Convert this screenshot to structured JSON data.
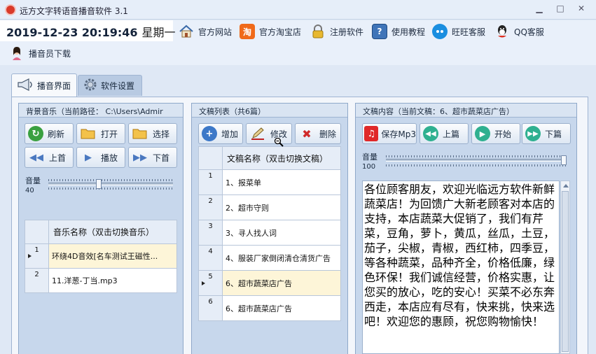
{
  "window": {
    "title": "远方文字转语音播音软件 3.1",
    "minimize_label": "▭",
    "restore_label": "□",
    "close_label": "✕"
  },
  "toolbar": {
    "date": "2019-12-23 20:19:46",
    "weekday": "星期一",
    "items": [
      {
        "label": "官方网站",
        "icon": "home-icon"
      },
      {
        "label": "官方淘宝店",
        "icon": "taobao-icon",
        "glyph": "淘"
      },
      {
        "label": "注册软件",
        "icon": "lock-icon"
      },
      {
        "label": "使用教程",
        "icon": "help-book-icon",
        "glyph": "?"
      },
      {
        "label": "旺旺客服",
        "icon": "wangwang-icon"
      },
      {
        "label": "QQ客服",
        "icon": "qq-icon"
      },
      {
        "label": "播音员下载",
        "icon": "announcer-icon"
      }
    ]
  },
  "tabs": [
    {
      "label": "播音界面",
      "active": true
    },
    {
      "label": "软件设置",
      "active": false
    }
  ],
  "music_panel": {
    "title": "背景音乐（当前路径：  C:\\Users\\Admir",
    "buttons": [
      "刷新",
      "打开",
      "选择",
      "上首",
      "播放",
      "下首"
    ],
    "volume_label": "音量",
    "volume_value": "40",
    "volume_level": 0.4,
    "table_header": "音乐名称（双击切换音乐）",
    "rows": [
      {
        "num": "1",
        "name": "环绕4D音效[名车测试王磁性...",
        "selected": true
      },
      {
        "num": "2",
        "name": "11.洋葱-丁当.mp3",
        "selected": false
      }
    ]
  },
  "script_panel": {
    "title": "文稿列表（共6篇）",
    "buttons": [
      "增加",
      "修改",
      "删除"
    ],
    "table_header": "文稿名称（双击切换文稿）",
    "rows": [
      {
        "num": "1",
        "name": "1、报菜单",
        "selected": false
      },
      {
        "num": "2",
        "name": "2、超市守则",
        "selected": false
      },
      {
        "num": "3",
        "name": "3、寻人找人词",
        "selected": false
      },
      {
        "num": "4",
        "name": "4、服装厂家倒闭清仓清货广告",
        "selected": false
      },
      {
        "num": "5",
        "name": "6、超市蔬菜店广告",
        "selected": true
      },
      {
        "num": "6",
        "name": "6、超市蔬菜店广告",
        "selected": false
      }
    ]
  },
  "content_panel": {
    "title": "文稿内容（当前文稿：6、超市蔬菜店广告）",
    "buttons": [
      "保存Mp3",
      "上篇",
      "开始",
      "下篇"
    ],
    "volume_label": "音量",
    "volume_value": "100",
    "volume_level": 1.0,
    "text": "各位顾客朋友，欢迎光临远方软件新鲜蔬菜店！为回馈广大新老顾客对本店的支持，本店蔬菜大促销了，我们有芹菜，豆角，萝卜，黄瓜，丝瓜，土豆，茄子，尖椒，青椒，西红柿，四季豆，等各种蔬菜，品种齐全，价格低廉，绿色环保！我们诚信经营，价格实惠，让您买的放心，吃的安心！买菜不必东奔西走，本店应有尽有，快来挑，快来选吧！欢迎您的惠顾，祝您购物愉快！"
  }
}
